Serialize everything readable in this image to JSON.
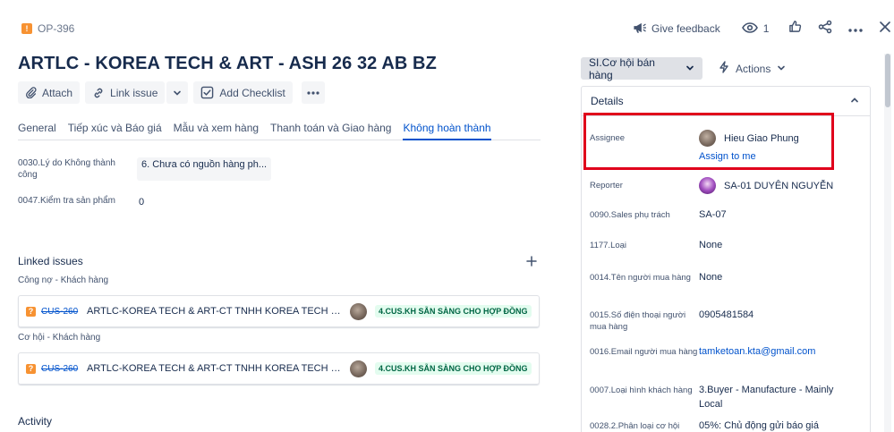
{
  "issue": {
    "key": "OP-396",
    "title": "ARTLC - KOREA TECH & ART - ASH 26 32 AB BZ"
  },
  "toolbar": {
    "attach": "Attach",
    "link_issue": "Link issue",
    "add_checklist": "Add Checklist"
  },
  "tabs": [
    {
      "label": "General",
      "active": false
    },
    {
      "label": "Tiếp xúc và Báo giá",
      "active": false
    },
    {
      "label": "Mẫu và xem hàng",
      "active": false
    },
    {
      "label": "Thanh toán và Giao hàng",
      "active": false
    },
    {
      "label": "Không hoàn thành",
      "active": true
    }
  ],
  "fields": [
    {
      "label": "0030.Lý do Không thành công",
      "value": "6. Chưa có nguồn hàng ph..."
    },
    {
      "label": "0047.Kiểm tra sản phẩm",
      "value": "0"
    }
  ],
  "linked_issues": {
    "title": "Linked issues",
    "groups": [
      {
        "label": "Công nợ - Khách hàng",
        "key": "CUS-260",
        "summary": "ARTLC-KOREA TECH & ART-CT TNHH KOREA TECH & A...",
        "status": "4.CUS.KH SẴN SÀNG CHO HỢP ĐỒNG"
      },
      {
        "label": "Cơ hội - Khách hàng",
        "key": "CUS-260",
        "summary": "ARTLC-KOREA TECH & ART-CT TNHH KOREA TECH & A...",
        "status": "4.CUS.KH SẴN SÀNG CHO HỢP ĐỒNG"
      }
    ]
  },
  "activity": {
    "title": "Activity"
  },
  "top_actions": {
    "feedback": "Give feedback",
    "watch_count": "1"
  },
  "status_button": {
    "label": "SI.Cơ hội bán hàng"
  },
  "actions_button": {
    "label": "Actions"
  },
  "details": {
    "title": "Details",
    "assignee": {
      "label": "Assignee",
      "name": "Hieu Giao Phung",
      "assign_me": "Assign to me"
    },
    "reporter": {
      "label": "Reporter",
      "name": "SA-01 DUYÊN NGUYỄN"
    },
    "rows": [
      {
        "label": "0090.Sales phụ trách",
        "value": "SA-07"
      },
      {
        "label": "1177.Loại",
        "value": "None"
      },
      {
        "label": "0014.Tên người mua hàng",
        "value": "None"
      },
      {
        "label": "0015.Số điện thoại người mua hàng",
        "value": "0905481584"
      },
      {
        "label": "0016.Email người mua hàng",
        "value": "tamketoan.kta@gmail.com"
      },
      {
        "label": "0007.Loại hình khách hàng",
        "value": "3.Buyer - Manufacture - Mainly Local"
      },
      {
        "label": "0028.2.Phân loại cơ hội",
        "value": "05%: Chủ động gửi báo giá"
      }
    ]
  },
  "colors": {
    "accent": "#0052cc",
    "highlight": "#e0001b",
    "status_bg": "#e3fcef",
    "status_text": "#006644"
  }
}
